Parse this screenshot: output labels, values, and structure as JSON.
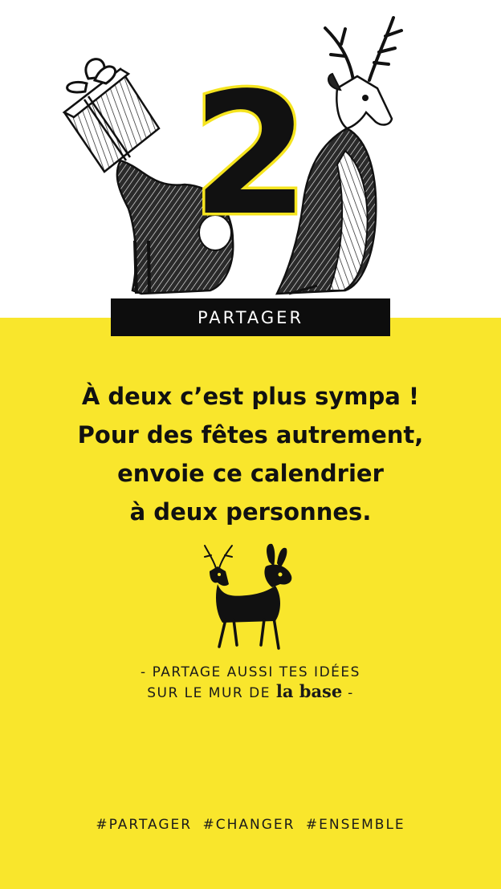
{
  "day": {
    "number": "2"
  },
  "badge": {
    "label": "PARTAGER"
  },
  "headline": {
    "lines": [
      "À deux c’est plus sympa !",
      "Pour des fêtes autrement,",
      "envoie ce calendrier",
      "à deux personnes."
    ]
  },
  "subtext": {
    "line1": "- PARTAGE AUSSI TES IDÉES",
    "line2_prefix": "SUR LE MUR DE",
    "brand": "la base",
    "line2_suffix": "-"
  },
  "hashtags": [
    "#PARTAGER",
    "#CHANGER",
    "#ENSEMBLE"
  ],
  "colors": {
    "yellow": "#f9e62c",
    "black": "#0d0d0d",
    "white": "#ffffff"
  },
  "icons": [
    "rabbit-with-gift-illustration",
    "deer-illustration",
    "deer-rabbit-illustration"
  ]
}
